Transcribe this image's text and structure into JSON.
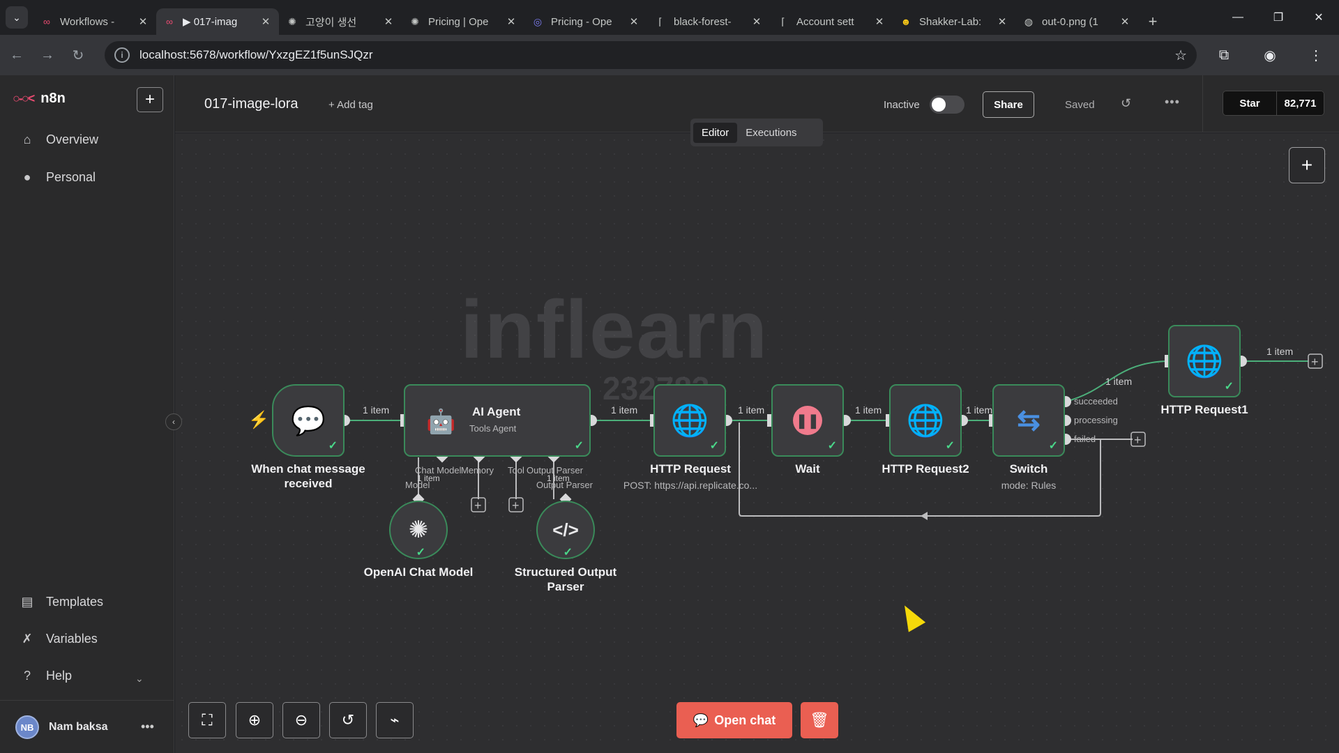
{
  "browser": {
    "tabs": [
      {
        "title": "Workflows -",
        "fav": "n8n-icon"
      },
      {
        "title": "▶ 017-imag",
        "fav": "n8n-icon",
        "active": true
      },
      {
        "title": "고양이 생선",
        "fav": "openai-icon"
      },
      {
        "title": "Pricing | Ope",
        "fav": "openai-icon"
      },
      {
        "title": "Pricing - Ope",
        "fav": "globe-icon"
      },
      {
        "title": "black-forest-",
        "fav": "replicate-icon"
      },
      {
        "title": "Account sett",
        "fav": "replicate-icon"
      },
      {
        "title": "Shakker-Lab:",
        "fav": "huggingface-icon"
      },
      {
        "title": "out-0.png (1",
        "fav": "globe-icon"
      }
    ],
    "url": "localhost:5678/workflow/YxzgEZ1f5unSJQzr"
  },
  "sidebar": {
    "brand": "n8n",
    "items_top": [
      {
        "label": "Overview",
        "icon": "home-icon"
      },
      {
        "label": "Personal",
        "icon": "user-icon"
      }
    ],
    "items_bottom": [
      {
        "label": "Templates",
        "icon": "templates-icon"
      },
      {
        "label": "Variables",
        "icon": "variables-icon"
      },
      {
        "label": "Help",
        "icon": "help-icon"
      }
    ],
    "user": {
      "initials": "NB",
      "name": "Nam baksa"
    }
  },
  "header": {
    "workflow_name": "017-image-lora",
    "add_tag": "+ Add tag",
    "status": "Inactive",
    "share": "Share",
    "saved": "Saved",
    "github_star": "Star",
    "github_count": "82,771"
  },
  "view_tabs": {
    "editor": "Editor",
    "executions": "Executions"
  },
  "nodes": {
    "trigger": "When chat message received",
    "agent": {
      "title": "AI Agent",
      "sub": "Tools Agent"
    },
    "http1": {
      "title": "HTTP Request",
      "sub": "POST: https://api.replicate.co..."
    },
    "wait": "Wait",
    "http2": "HTTP Request2",
    "switch": {
      "title": "Switch",
      "sub": "mode: Rules"
    },
    "http3": "HTTP Request1",
    "openai": "OpenAI Chat Model",
    "parser": "Structured Output Parser"
  },
  "edge_labels": {
    "item": "1 item"
  },
  "port_labels": {
    "chat_model": "Chat Model",
    "model": "Model",
    "memory": "Memory",
    "tool": "Tool",
    "output_parser": "Output Parser",
    "succeeded": "succeeded",
    "processing": "processing",
    "failed": "failed"
  },
  "watermark": {
    "text": "inflearn",
    "num": "232783"
  },
  "actions": {
    "open_chat": "Open chat"
  }
}
